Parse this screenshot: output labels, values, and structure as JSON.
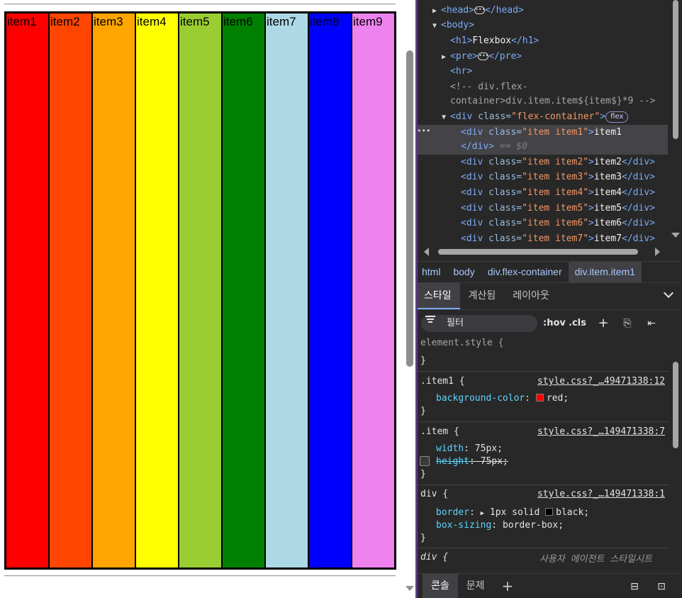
{
  "page": {
    "items": [
      {
        "label": "item1",
        "color": "#ff0000"
      },
      {
        "label": "item2",
        "color": "#ff4500"
      },
      {
        "label": "item3",
        "color": "#ffa500"
      },
      {
        "label": "item4",
        "color": "#ffff00"
      },
      {
        "label": "item5",
        "color": "#9acd32"
      },
      {
        "label": "item6",
        "color": "#008000"
      },
      {
        "label": "item7",
        "color": "#add8e6"
      },
      {
        "label": "item8",
        "color": "#0000ff"
      },
      {
        "label": "item9",
        "color": "#ee82ee"
      }
    ]
  },
  "elements": {
    "head_open": "<head>",
    "head_close": "</head>",
    "body_open": "<body>",
    "h1_open": "<h1>",
    "h1_text": "Flexbox",
    "h1_close": "</h1>",
    "pre_open": "<pre>",
    "pre_close": "</pre>",
    "hr": "<hr>",
    "comment_1": "<!-- div.flex-",
    "comment_2": "container>div.item.item${item$}*9 -->",
    "flex_div_tag": "<div",
    "attr_class": "class=",
    "flex_class_value": "\"flex-container\"",
    "tag_end": ">",
    "flex_badge": "flex",
    "selected_class_value": "\"item item1\"",
    "selected_text": "item1",
    "close_div": "</div>",
    "dollar_zero": "== $0",
    "rows": [
      {
        "class_value": "\"item item2\"",
        "text": "item2"
      },
      {
        "class_value": "\"item item3\"",
        "text": "item3"
      },
      {
        "class_value": "\"item item4\"",
        "text": "item4"
      },
      {
        "class_value": "\"item item5\"",
        "text": "item5"
      },
      {
        "class_value": "\"item item6\"",
        "text": "item6"
      },
      {
        "class_value": "\"item item7\"",
        "text": "item7"
      }
    ]
  },
  "breadcrumbs": [
    "html",
    "body",
    "div.flex-container",
    "div.item.item1"
  ],
  "subtabs": [
    "스타일",
    "계산됨",
    "레이아웃"
  ],
  "filter": {
    "placeholder": "필터",
    "hov": ":hov",
    "cls": ".cls"
  },
  "styles": {
    "element_style": "element.style {",
    "close_brace": "}",
    "rule1": {
      "selector": ".item1 {",
      "source": "style.css?_…49471338:12",
      "prop": "background-color",
      "value": "red",
      "swatch": "#ff0000"
    },
    "rule2": {
      "selector": ".item {",
      "source": "style.css?_…149471338:7",
      "prop1": "width",
      "value1": "75px;",
      "prop2": "height",
      "value2": "75px;"
    },
    "rule3": {
      "selector": "div {",
      "source": "style.css?_…149471338:1",
      "prop1": "border",
      "value1": "1px solid",
      "value1b": "black;",
      "swatch": "#000000",
      "prop2": "box-sizing",
      "value2": "border-box;"
    },
    "rule4": {
      "selector": "div {",
      "source": "사용자 에이전트 스타일시트"
    }
  },
  "drawer": {
    "tabs": [
      "콘솔",
      "문제"
    ]
  }
}
